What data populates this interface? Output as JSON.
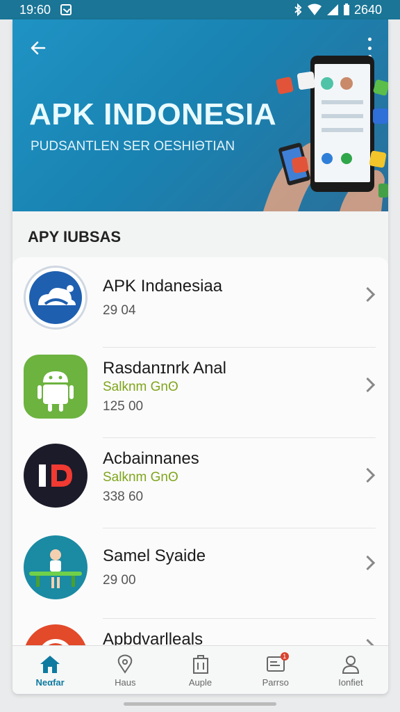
{
  "status_bar": {
    "time": "19:60",
    "right_text": "2640",
    "icons": [
      "notification-icon",
      "bluetooth-icon",
      "wifi-icon",
      "signal-icon",
      "battery-icon"
    ]
  },
  "hero": {
    "title": "APK INDONESIA",
    "subtitle": "PUDSANTLEN SER OESHIƏTIAN",
    "back_icon": "back-arrow-icon",
    "menu_icon": "more-vert-icon",
    "gradient": [
      "#1f93c4",
      "#2a6f9a"
    ]
  },
  "section": {
    "title": "APY IUBSAS"
  },
  "apps": [
    {
      "name": "APK Indanesiaa",
      "tag": "",
      "meta": "29 04",
      "icon": "cloud-app-icon",
      "color": "#1e5fb0"
    },
    {
      "name": "Rasdanɪnrk Anal",
      "tag": "Salknm Gnʘ",
      "meta": "125 00",
      "icon": "android-icon",
      "color": "#6cb33f"
    },
    {
      "name": "Acbainnanes",
      "tag": "Salknm Gnʘ",
      "meta": "338 60",
      "icon": "id-logo-icon",
      "color": "#1b1b2a"
    },
    {
      "name": "Samel Syaide",
      "tag": "",
      "meta": "29 00",
      "icon": "person-at-table-icon",
      "color": "#1b8aa3"
    },
    {
      "name": "Apbdvarlleals",
      "tag": "",
      "meta": "",
      "icon": "red-ring-icon",
      "color": "#e24a2a"
    }
  ],
  "nav": [
    {
      "label": "Neαfar",
      "icon": "home-icon",
      "active": true
    },
    {
      "label": "Haus",
      "icon": "location-pin-icon",
      "active": false
    },
    {
      "label": "Auple",
      "icon": "building-icon",
      "active": false
    },
    {
      "label": "Parrso",
      "icon": "inbox-icon",
      "active": false,
      "badge": "1"
    },
    {
      "label": "Ionfiet",
      "icon": "person-icon",
      "active": false
    }
  ],
  "colors": {
    "accent": "#0e7aa0",
    "tag_green": "#7fa51b"
  }
}
